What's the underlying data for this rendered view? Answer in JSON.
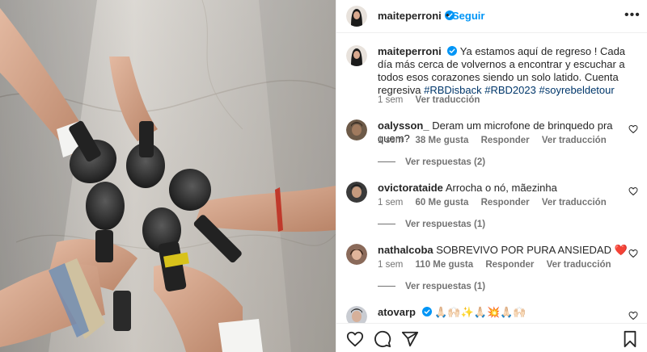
{
  "post": {
    "username": "maiteperroni",
    "dot": "•",
    "follow_label": "Seguir",
    "more_label": "•••",
    "caption": {
      "username": "maiteperroni",
      "text": "Ya estamos aquí de regreso ! Cada día más cerca de volvernos a encontrar y escuchar a todos esos corazones siendo un solo latido. Cuenta regresiva",
      "hashtags": [
        "#RBDisback",
        "#RBD2023",
        "#soyrebeldetour"
      ],
      "time": "1 sem",
      "translate": "Ver traducción"
    }
  },
  "comments": [
    {
      "username": "oalysson_",
      "text": "Deram um microfone de brinquedo pra quem?",
      "time": "1 sem",
      "likes": "38 Me gusta",
      "reply": "Responder",
      "translate": "Ver traducción",
      "replies": "Ver respuestas (2)"
    },
    {
      "username": "ovictorataide",
      "text": "Arrocha o nó, mãezinha",
      "time": "1 sem",
      "likes": "60 Me gusta",
      "reply": "Responder",
      "translate": "Ver traducción",
      "replies": "Ver respuestas (1)"
    },
    {
      "username": "nathalcoba",
      "text": "SOBREVIVO POR PURA ANSIEDAD ❤️",
      "time": "1 sem",
      "likes": "110 Me gusta",
      "reply": "Responder",
      "translate": "Ver traducción",
      "replies": "Ver respuestas (1)"
    },
    {
      "username": "atovarp",
      "text": "🙏🏻🙌🏻✨🙏🏻💥🙏🏻🙌🏻"
    }
  ],
  "colors": {
    "link_blue": "#0095f6",
    "hashtag": "#00376b",
    "secondary": "#737373",
    "heart_red": "#ed4956"
  },
  "icons": [
    "verified-badge-icon",
    "heart-icon",
    "comment-icon",
    "share-icon",
    "bookmark-icon",
    "more-options-icon"
  ]
}
